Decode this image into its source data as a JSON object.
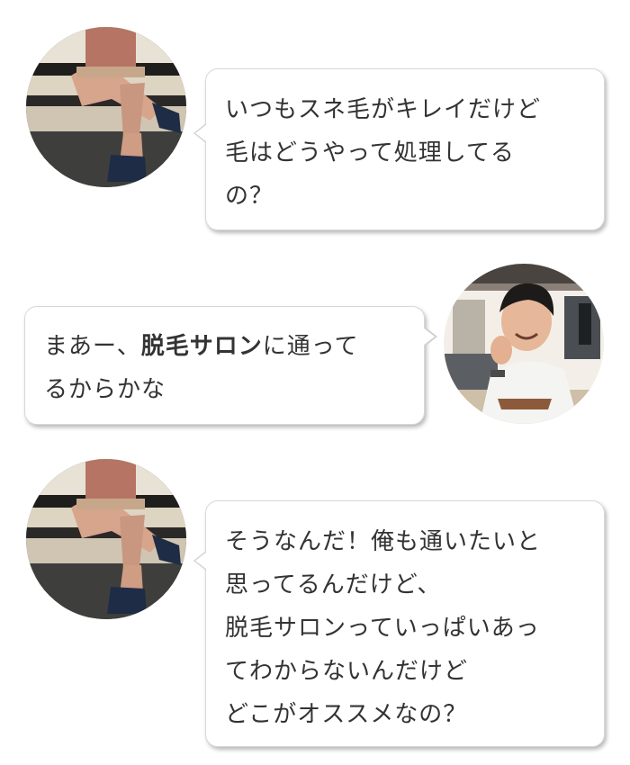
{
  "conversation": {
    "message_1": {
      "speaker": "friend",
      "avatar_icon": "person-sitting-on-bench-avatar",
      "lines": [
        "いつもスネ毛がキレイだけど",
        "毛はどうやって処理してる",
        "の？"
      ]
    },
    "message_2": {
      "speaker": "self",
      "avatar_icon": "smiling-man-avatar",
      "line1_before": "まあー、",
      "line1_bold": "脱毛サロン",
      "line1_after": "に通って",
      "line2": "るからかな"
    },
    "message_3": {
      "speaker": "friend",
      "avatar_icon": "person-sitting-on-bench-avatar",
      "lines": [
        "そうなんだ！俺も通いたいと",
        "思ってるんだけど、",
        "脱毛サロンっていっぱいあっ",
        "てわからないんだけど",
        "どこがオススメなの？"
      ]
    }
  },
  "colors": {
    "bubble_background": "#ffffff",
    "bubble_border": "#d8d8d8",
    "text": "#333333",
    "page_background": "#ffffff"
  }
}
